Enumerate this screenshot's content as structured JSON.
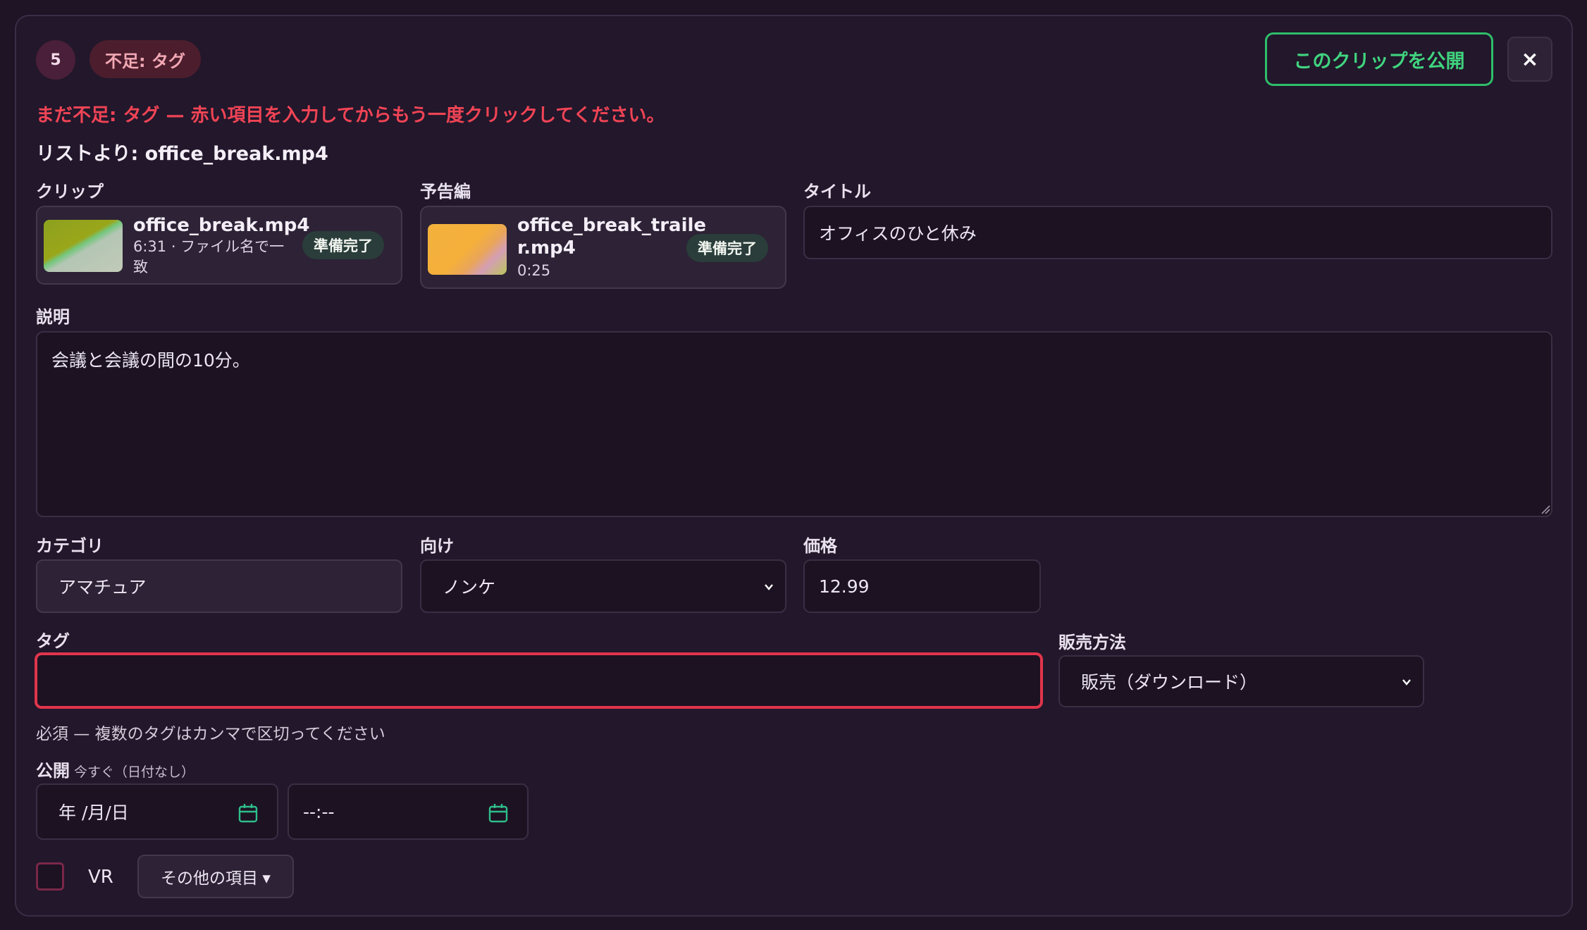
{
  "header": {
    "index_badge": "5",
    "missing_badge": "不足: タグ",
    "publish_label": "このクリップを公開",
    "close_label": "×"
  },
  "error_message": "まだ不足: タグ — 赤い項目を入力してからもう一度クリックしてください。",
  "from_list": {
    "prefix": "リストより: ",
    "filename": "office_break.mp4"
  },
  "clip": {
    "label": "クリップ",
    "name": "office_break.mp4",
    "meta_line1": "6:31 · ファイル名で一",
    "meta_line2": "致",
    "status": "準備完了"
  },
  "trailer": {
    "label": "予告編",
    "name_line1": "office_break_traile",
    "name_line2": "r.mp4",
    "duration": "0:25",
    "status": "準備完了"
  },
  "title_field": {
    "label": "タイトル",
    "value": "オフィスのひと休み"
  },
  "description": {
    "label": "説明",
    "value": "会議と会議の間の10分。"
  },
  "category": {
    "label": "カテゴリ",
    "value": "アマチュア"
  },
  "audience": {
    "label": "向け",
    "value": "ノンケ"
  },
  "price": {
    "label": "価格",
    "value": "12.99"
  },
  "tags": {
    "label": "タグ",
    "value": "",
    "hint": "必須 — 複数のタグはカンマで区切ってください"
  },
  "sale_method": {
    "label": "販売方法",
    "value": "販売（ダウンロード）"
  },
  "publish": {
    "label": "公開",
    "sub_label": "今すぐ（日付なし）",
    "date_placeholder": "年 /月/日",
    "time_placeholder": "--:--"
  },
  "vr": {
    "label": "VR"
  },
  "more_items_label": "その他の項目 ▾",
  "colors": {
    "background": "#1f1426",
    "accent_green": "#40d37e",
    "error_red": "#f04455",
    "calendar_icon": "#2fbe8a"
  }
}
